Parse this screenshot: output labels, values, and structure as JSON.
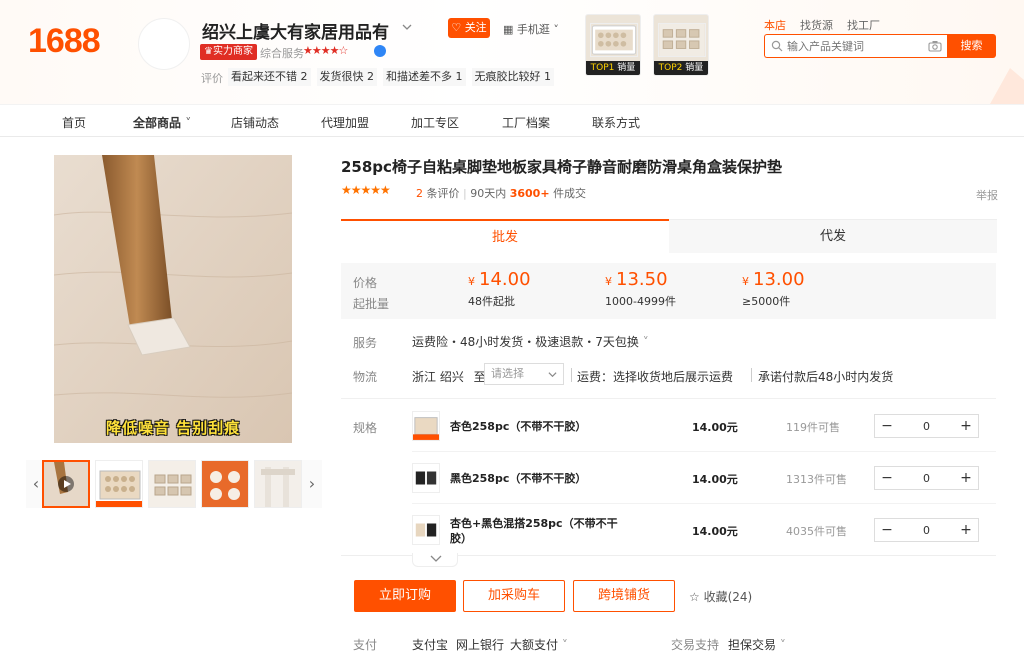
{
  "header": {
    "logo": "1688",
    "shop_name": "绍兴上虞大有家居用品有",
    "follow_label": "关注",
    "mobile_label": "手机逛",
    "strength_badge": "实力商家",
    "service_label": "综合服务",
    "rating_stars": "★★★★☆",
    "review_label": "评价",
    "review_tags": [
      "看起来还不错 2",
      "发货很快 2",
      "和描述差不多 1",
      "无痕胶比较好 1"
    ],
    "top_products": [
      {
        "rank": "TOP1",
        "label": "销量"
      },
      {
        "rank": "TOP2",
        "label": "销量"
      }
    ],
    "search_tabs": [
      "本店",
      "找货源",
      "找工厂"
    ],
    "search_placeholder": "输入产品关键词",
    "search_button": "搜索"
  },
  "nav": {
    "items": [
      "首页",
      "全部商品",
      "店铺动态",
      "代理加盟",
      "加工专区",
      "工厂档案",
      "联系方式"
    ]
  },
  "gallery": {
    "caption": "降低噪音 告别刮痕"
  },
  "product": {
    "title": "258pc椅子自粘桌脚垫地板家具椅子静音耐磨防滑桌角盒装保护垫",
    "stars": "★★★★★",
    "review_count": "2",
    "review_suffix": "条评价",
    "sold_prefix": "90天内",
    "sold_count": "3600+",
    "sold_suffix": "件成交",
    "report": "举报",
    "tabs": [
      "批发",
      "代发"
    ],
    "price_label": "价格",
    "moq_label": "起批量",
    "currency": "¥",
    "price_tiers": [
      {
        "price": "14.00",
        "moq": "48件起批"
      },
      {
        "price": "13.50",
        "moq": "1000-4999件"
      },
      {
        "price": "13.00",
        "moq": "≥5000件"
      }
    ],
    "service_label": "服务",
    "service_text": "运费险・48小时发货・极速退款・7天包换",
    "logistics_label": "物流",
    "ship_from": "浙江 绍兴",
    "ship_to": "至",
    "ship_select_placeholder": "请选择",
    "freight_text": "运费：选择收货地后展示运费",
    "promise_text": "承诺付款后48小时内发货",
    "spec_label": "规格",
    "specs": [
      {
        "name": "杏色258pc（不带不干胶）",
        "price": "14.00元",
        "stock": "119件可售",
        "qty": "0"
      },
      {
        "name": "黑色258pc（不带不干胶）",
        "price": "14.00元",
        "stock": "1313件可售",
        "qty": "0"
      },
      {
        "name": "杏色+黑色混搭258pc（不带不干胶）",
        "price": "14.00元",
        "stock": "4035件可售",
        "qty": "0"
      }
    ],
    "buy_now": "立即订购",
    "add_cart": "加采购车",
    "cross_border": "跨境铺货",
    "collect": "收藏(24)",
    "pay_label": "支付",
    "pay_methods": [
      "支付宝",
      "网上银行",
      "大额支付"
    ],
    "trade_label": "交易支持",
    "trade_value": "担保交易"
  },
  "colors": {
    "brand": "#ff5000",
    "badge_red": "#e02e24"
  }
}
